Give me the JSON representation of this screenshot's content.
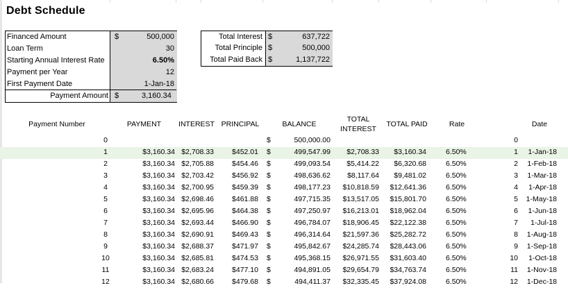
{
  "title": "Debt Schedule",
  "inputs": [
    {
      "label": "Financed Amount",
      "currency": "$",
      "value": "500,000"
    },
    {
      "label": "Loan Term",
      "currency": "",
      "value": "30"
    },
    {
      "label": "Starting Annual Interest Rate",
      "currency": "",
      "value": "6.50%"
    },
    {
      "label": "Payment per Year",
      "currency": "",
      "value": "12"
    },
    {
      "label": "First Payment Date",
      "currency": "",
      "value": "1-Jan-18"
    },
    {
      "label": "Payment Amount",
      "currency": "$",
      "value": "3,160.34"
    }
  ],
  "totals": [
    {
      "label": "Total Interest",
      "currency": "$",
      "value": "637,722"
    },
    {
      "label": "Total Principle",
      "currency": "$",
      "value": "500,000"
    },
    {
      "label": "Total Paid Back",
      "currency": "$",
      "value": "1,137,722"
    }
  ],
  "headers": {
    "payment_number": "Payment Number",
    "payment": "PAYMENT",
    "interest": "INTEREST",
    "principal": "PRINCIPAL",
    "balance": "BALANCE",
    "total_interest_1": "TOTAL",
    "total_interest_2": "INTEREST",
    "total_paid": "TOTAL PAID",
    "rate": "Rate",
    "date": "Date"
  },
  "rows": [
    {
      "n": "0",
      "payment": "",
      "interest": "",
      "principal": "",
      "cur": "$",
      "balance": "500,000.00",
      "tint": "",
      "tpaid": "",
      "rate": "",
      "idx": "0",
      "date": ""
    },
    {
      "n": "1",
      "payment": "$3,160.34",
      "interest": "$2,708.33",
      "principal": "$452.01",
      "cur": "$",
      "balance": "499,547.99",
      "tint": "$2,708.33",
      "tpaid": "$3,160.34",
      "rate": "6.50%",
      "idx": "1",
      "date": "1-Jan-18"
    },
    {
      "n": "2",
      "payment": "$3,160.34",
      "interest": "$2,705.88",
      "principal": "$454.46",
      "cur": "$",
      "balance": "499,093.54",
      "tint": "$5,414.22",
      "tpaid": "$6,320.68",
      "rate": "6.50%",
      "idx": "2",
      "date": "1-Feb-18"
    },
    {
      "n": "3",
      "payment": "$3,160.34",
      "interest": "$2,703.42",
      "principal": "$456.92",
      "cur": "$",
      "balance": "498,636.62",
      "tint": "$8,117.64",
      "tpaid": "$9,481.02",
      "rate": "6.50%",
      "idx": "3",
      "date": "1-Mar-18"
    },
    {
      "n": "4",
      "payment": "$3,160.34",
      "interest": "$2,700.95",
      "principal": "$459.39",
      "cur": "$",
      "balance": "498,177.23",
      "tint": "$10,818.59",
      "tpaid": "$12,641.36",
      "rate": "6.50%",
      "idx": "4",
      "date": "1-Apr-18"
    },
    {
      "n": "5",
      "payment": "$3,160.34",
      "interest": "$2,698.46",
      "principal": "$461.88",
      "cur": "$",
      "balance": "497,715.35",
      "tint": "$13,517.05",
      "tpaid": "$15,801.70",
      "rate": "6.50%",
      "idx": "5",
      "date": "1-May-18"
    },
    {
      "n": "6",
      "payment": "$3,160.34",
      "interest": "$2,695.96",
      "principal": "$464.38",
      "cur": "$",
      "balance": "497,250.97",
      "tint": "$16,213.01",
      "tpaid": "$18,962.04",
      "rate": "6.50%",
      "idx": "6",
      "date": "1-Jun-18"
    },
    {
      "n": "7",
      "payment": "$3,160.34",
      "interest": "$2,693.44",
      "principal": "$466.90",
      "cur": "$",
      "balance": "496,784.07",
      "tint": "$18,906.45",
      "tpaid": "$22,122.38",
      "rate": "6.50%",
      "idx": "7",
      "date": "1-Jul-18"
    },
    {
      "n": "8",
      "payment": "$3,160.34",
      "interest": "$2,690.91",
      "principal": "$469.43",
      "cur": "$",
      "balance": "496,314.64",
      "tint": "$21,597.36",
      "tpaid": "$25,282.72",
      "rate": "6.50%",
      "idx": "8",
      "date": "1-Aug-18"
    },
    {
      "n": "9",
      "payment": "$3,160.34",
      "interest": "$2,688.37",
      "principal": "$471.97",
      "cur": "$",
      "balance": "495,842.67",
      "tint": "$24,285.74",
      "tpaid": "$28,443.06",
      "rate": "6.50%",
      "idx": "9",
      "date": "1-Sep-18"
    },
    {
      "n": "10",
      "payment": "$3,160.34",
      "interest": "$2,685.81",
      "principal": "$474.53",
      "cur": "$",
      "balance": "495,368.15",
      "tint": "$26,971.55",
      "tpaid": "$31,603.40",
      "rate": "6.50%",
      "idx": "10",
      "date": "1-Oct-18"
    },
    {
      "n": "11",
      "payment": "$3,160.34",
      "interest": "$2,683.24",
      "principal": "$477.10",
      "cur": "$",
      "balance": "494,891.05",
      "tint": "$29,654.79",
      "tpaid": "$34,763.74",
      "rate": "6.50%",
      "idx": "11",
      "date": "1-Nov-18"
    },
    {
      "n": "12",
      "payment": "$3,160.34",
      "interest": "$2,680.66",
      "principal": "$479.68",
      "cur": "$",
      "balance": "494,411.37",
      "tint": "$32,335.45",
      "tpaid": "$37,924.08",
      "rate": "6.50%",
      "idx": "12",
      "date": "1-Dec-18"
    }
  ]
}
